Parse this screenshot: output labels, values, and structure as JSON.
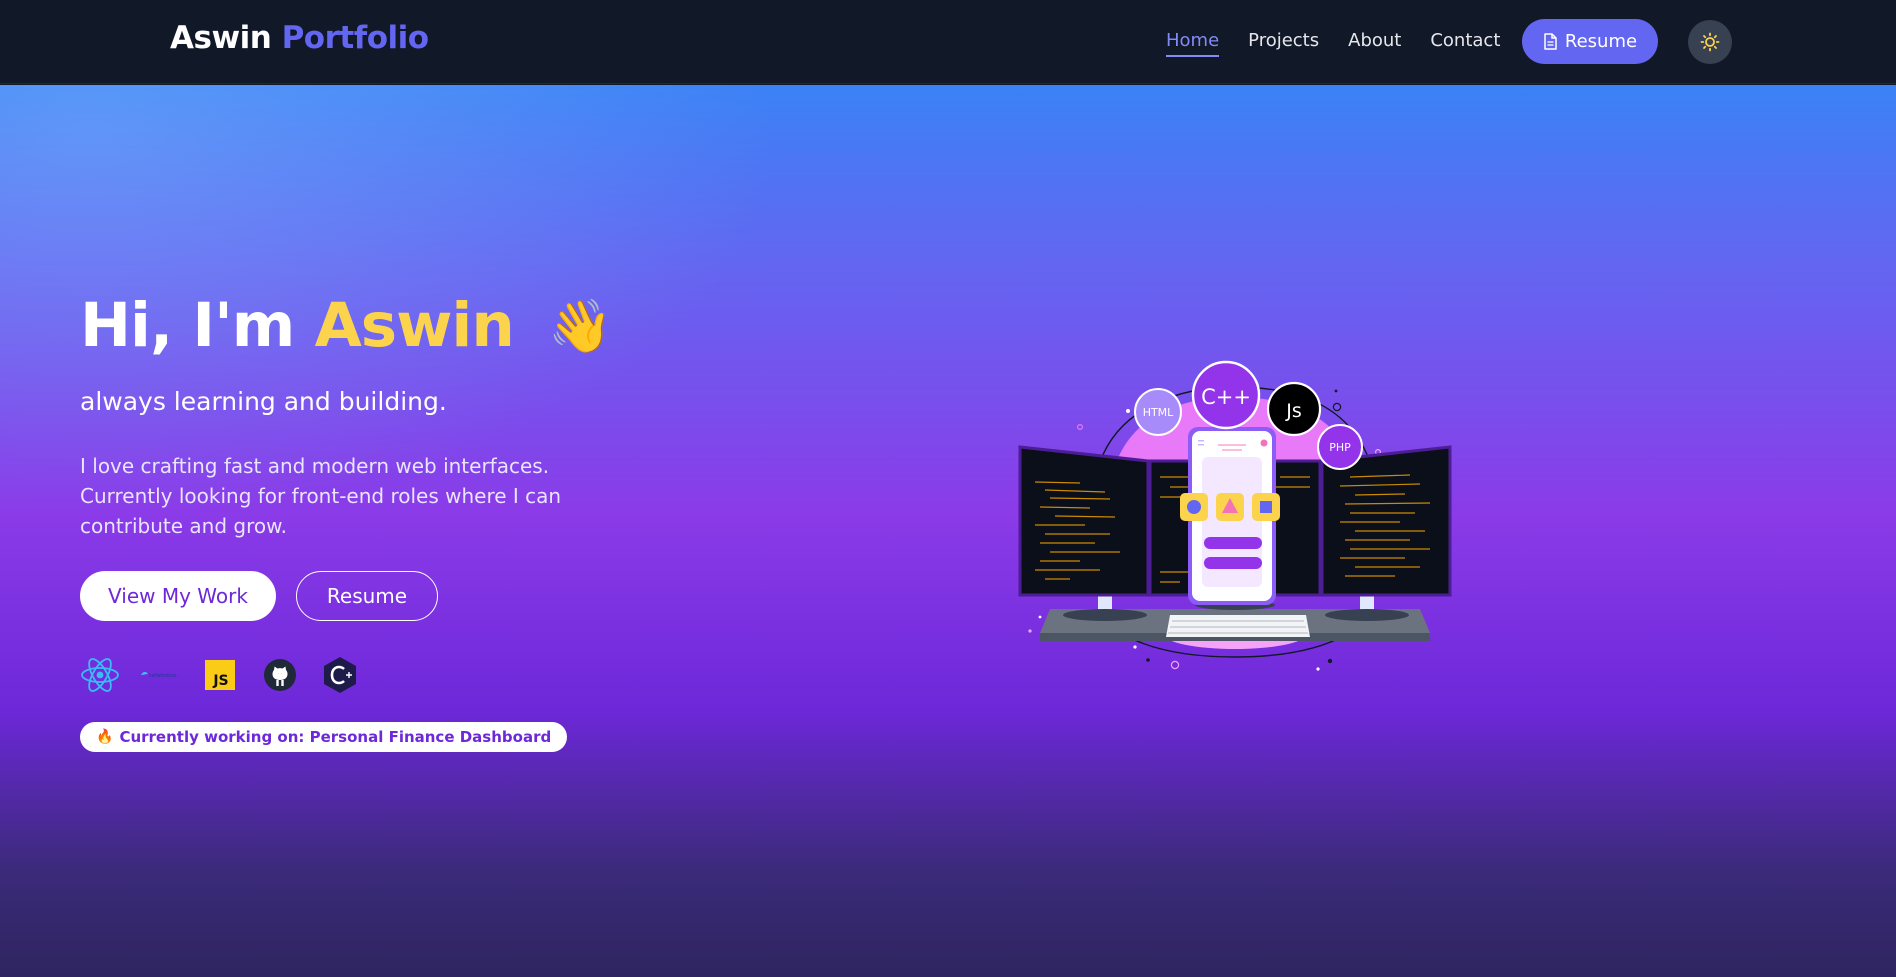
{
  "nav": {
    "brand_first": "Aswin",
    "brand_second": "Portfolio",
    "links": [
      "Home",
      "Projects",
      "About",
      "Contact"
    ],
    "resume_label": "Resume",
    "resume_icon": "file-icon",
    "theme_icon": "sun-icon"
  },
  "hero": {
    "greeting": "Hi, I'm",
    "name": "Aswin",
    "wave": "👋",
    "tagline": "always learning and building.",
    "intro": "I love crafting fast and modern web interfaces. Currently looking for front-end roles where I can contribute and grow.",
    "primary_cta": "View My Work",
    "secondary_cta": "Resume",
    "tech_icons": [
      "react-icon",
      "tailwind-icon",
      "javascript-icon",
      "github-icon",
      "cplusplus-icon"
    ],
    "tailwind_text": "tailwindcss",
    "js_text": "JS",
    "status_emoji": "🔥",
    "status_text": "Currently working on: Personal Finance Dashboard"
  },
  "illustration": {
    "badges": [
      "HTML",
      "C++",
      "Js",
      "PHP"
    ]
  },
  "colors": {
    "nav_bg": "#111827",
    "accent": "#6366f1",
    "name_yellow": "#fcd34d",
    "toggle_bg": "#374151"
  }
}
